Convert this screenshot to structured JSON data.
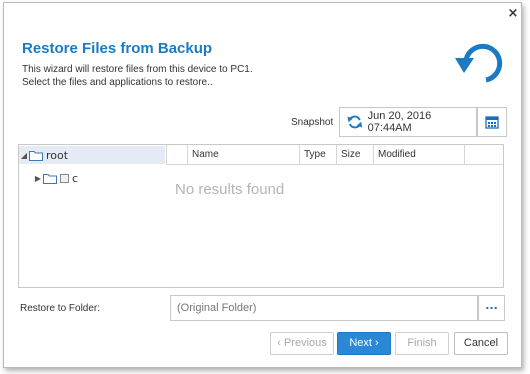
{
  "dialog": {
    "close_glyph": "×",
    "title": "Restore Files from Backup",
    "description_line1": "This wizard will restore files from this device to PC1.",
    "description_line2": "Select the files and applications to restore.."
  },
  "snapshot": {
    "label": "Snapshot",
    "value": "Jun 20, 2016 07:44AM"
  },
  "tree": {
    "items": [
      {
        "label": "root",
        "expander": "◢",
        "selected": true
      },
      {
        "label": "c",
        "expander": "▶"
      }
    ]
  },
  "grid": {
    "columns": [
      "Name",
      "Type",
      "Size",
      "Modified"
    ],
    "empty_message": "No results found"
  },
  "restore_folder": {
    "label": "Restore to Folder:",
    "value": "(Original Folder)",
    "browse_label": "..."
  },
  "buttons": {
    "previous": "‹ Previous",
    "next": "Next ›",
    "finish": "Finish",
    "cancel": "Cancel"
  },
  "colors": {
    "accent": "#1a7bc4",
    "primary_button": "#2a88d6",
    "selection": "#e5ebf5"
  },
  "icons": [
    "close-icon",
    "restore-arrow-icon",
    "sync-icon",
    "calendar-icon",
    "folder-icon",
    "checkbox-icon"
  ]
}
